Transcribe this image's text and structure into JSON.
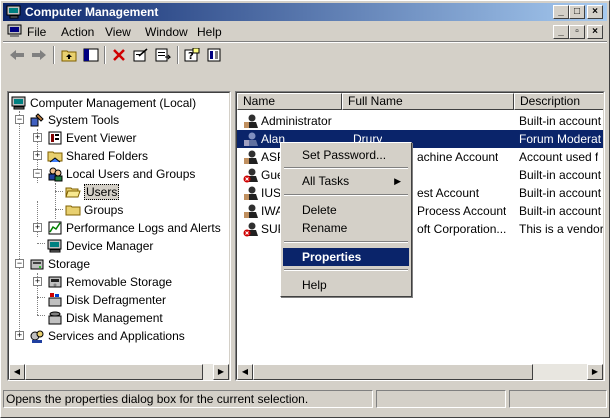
{
  "window": {
    "title": "Computer Management"
  },
  "menubar": {
    "items": [
      "File",
      "Action",
      "View",
      "Window",
      "Help"
    ]
  },
  "tree": {
    "root": "Computer Management (Local)",
    "system_tools": "System Tools",
    "event_viewer": "Event Viewer",
    "shared_folders": "Shared Folders",
    "local_users": "Local Users and Groups",
    "users": "Users",
    "groups": "Groups",
    "perf_logs": "Performance Logs and Alerts",
    "device_manager": "Device Manager",
    "storage": "Storage",
    "removable_storage": "Removable Storage",
    "disk_defrag": "Disk Defragmenter",
    "disk_mgmt": "Disk Management",
    "services_apps": "Services and Applications"
  },
  "list": {
    "columns": [
      "Name",
      "Full Name",
      "Description"
    ],
    "rows": [
      {
        "name": "Administrator",
        "full": "",
        "desc": "Built-in account"
      },
      {
        "name": "Alan",
        "full": "Drury",
        "desc": "Forum Moderat"
      },
      {
        "name": "ASP",
        "full": "achine Account",
        "desc": "Account used f"
      },
      {
        "name": "Gue",
        "full": "",
        "desc": "Built-in account"
      },
      {
        "name": "IUS",
        "full": "est Account",
        "desc": "Built-in account"
      },
      {
        "name": "IWA",
        "full": "Process Account",
        "desc": "Built-in account"
      },
      {
        "name": "SUP",
        "full": "oft Corporation...",
        "desc": "This is a vendor"
      }
    ]
  },
  "context_menu": {
    "set_password": "Set Password...",
    "all_tasks": "All Tasks",
    "delete": "Delete",
    "rename": "Rename",
    "properties": "Properties",
    "help": "Help"
  },
  "status": {
    "text": "Opens the properties dialog box for the current selection."
  },
  "colors": {
    "titlebar": "#0a246a",
    "selection": "#0a246a",
    "face": "#d4d0c8"
  }
}
